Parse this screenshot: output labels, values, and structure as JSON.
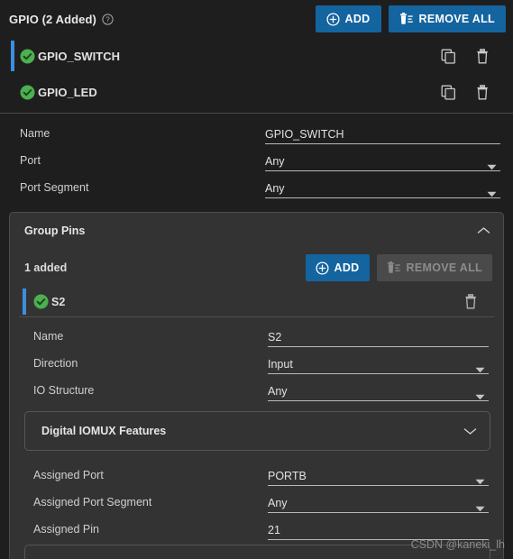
{
  "header": {
    "title": "GPIO (2 Added)",
    "help_icon": "help-circle-icon",
    "add_label": "ADD",
    "remove_all_label": "REMOVE ALL",
    "accent_color": "#1464a0"
  },
  "items": [
    {
      "name": "GPIO_SWITCH",
      "status_icon": "check-circle-icon",
      "selected": true,
      "copy_icon": "copy-icon",
      "delete_icon": "trash-icon"
    },
    {
      "name": "GPIO_LED",
      "status_icon": "check-circle-icon",
      "selected": false,
      "copy_icon": "copy-icon",
      "delete_icon": "trash-icon"
    }
  ],
  "form": {
    "rows": [
      {
        "label": "Name",
        "value": "GPIO_SWITCH",
        "type": "text"
      },
      {
        "label": "Port",
        "value": "Any",
        "type": "select"
      },
      {
        "label": "Port Segment",
        "value": "Any",
        "type": "select"
      }
    ]
  },
  "group_pins": {
    "title": "Group Pins",
    "expanded": true,
    "chevron_icon": "chevron-up-icon",
    "count_text": "1 added",
    "add_label": "ADD",
    "remove_all_label": "REMOVE ALL",
    "remove_all_disabled": true,
    "pins": [
      {
        "name": "S2",
        "status_icon": "check-circle-icon",
        "selected": true,
        "delete_icon": "trash-icon"
      }
    ],
    "form": {
      "rows": [
        {
          "label": "Name",
          "value": "S2",
          "type": "text"
        },
        {
          "label": "Direction",
          "value": "Input",
          "type": "select"
        },
        {
          "label": "IO Structure",
          "value": "Any",
          "type": "select"
        }
      ]
    },
    "digital_iomux": {
      "title": "Digital IOMUX Features",
      "expanded": false,
      "chevron_icon": "chevron-down-icon"
    },
    "assigned": {
      "rows": [
        {
          "label": "Assigned Port",
          "value": "PORTB",
          "type": "select"
        },
        {
          "label": "Assigned Port Segment",
          "value": "Any",
          "type": "select"
        },
        {
          "label": "Assigned Pin",
          "value": "21",
          "type": "text"
        }
      ]
    }
  },
  "watermark": "CSDN @kaneki_lh",
  "colors": {
    "background": "#1e1e1e",
    "panel": "#333333",
    "accent_blue": "#1464a0",
    "selection_blue": "#3b8fe0",
    "status_green": "#4caf50",
    "disabled_gray": "#4a4a4a"
  }
}
